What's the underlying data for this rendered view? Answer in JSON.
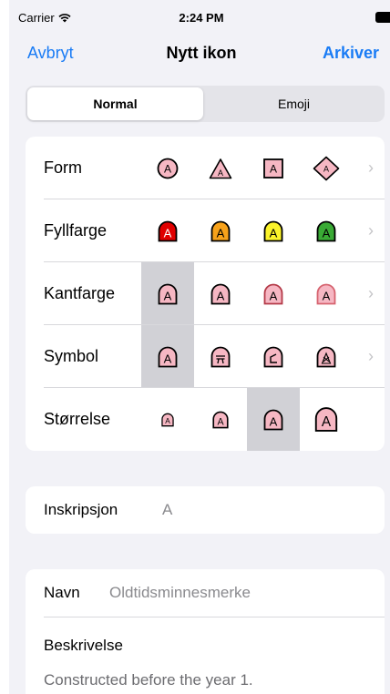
{
  "status_bar": {
    "carrier": "Carrier",
    "time": "2:24 PM"
  },
  "nav": {
    "cancel": "Avbryt",
    "title": "Nytt ikon",
    "save": "Arkiver"
  },
  "segments": {
    "normal": "Normal",
    "emoji": "Emoji"
  },
  "rows": {
    "form": "Form",
    "fill": "Fyllfarge",
    "border": "Kantfarge",
    "symbol": "Symbol",
    "size": "Størrelse"
  },
  "icon_letter": "A",
  "colors": {
    "accent": "#1a7cf5",
    "icon_pink": "#f6b7c3",
    "fill_red": "#e00000",
    "fill_orange": "#f7a21b",
    "fill_yellow": "#fbf32a",
    "fill_green": "#3aaa35"
  },
  "border_colors": [
    "#000000",
    "#f6b7c3",
    "#e25862",
    "#f3a0aa"
  ],
  "inscription": {
    "label": "Inskripsjon",
    "value": "A"
  },
  "name": {
    "label": "Navn",
    "value": "Oldtidsminnesmerke"
  },
  "description": {
    "label": "Beskrivelse",
    "value": "Constructed before the year 1."
  }
}
